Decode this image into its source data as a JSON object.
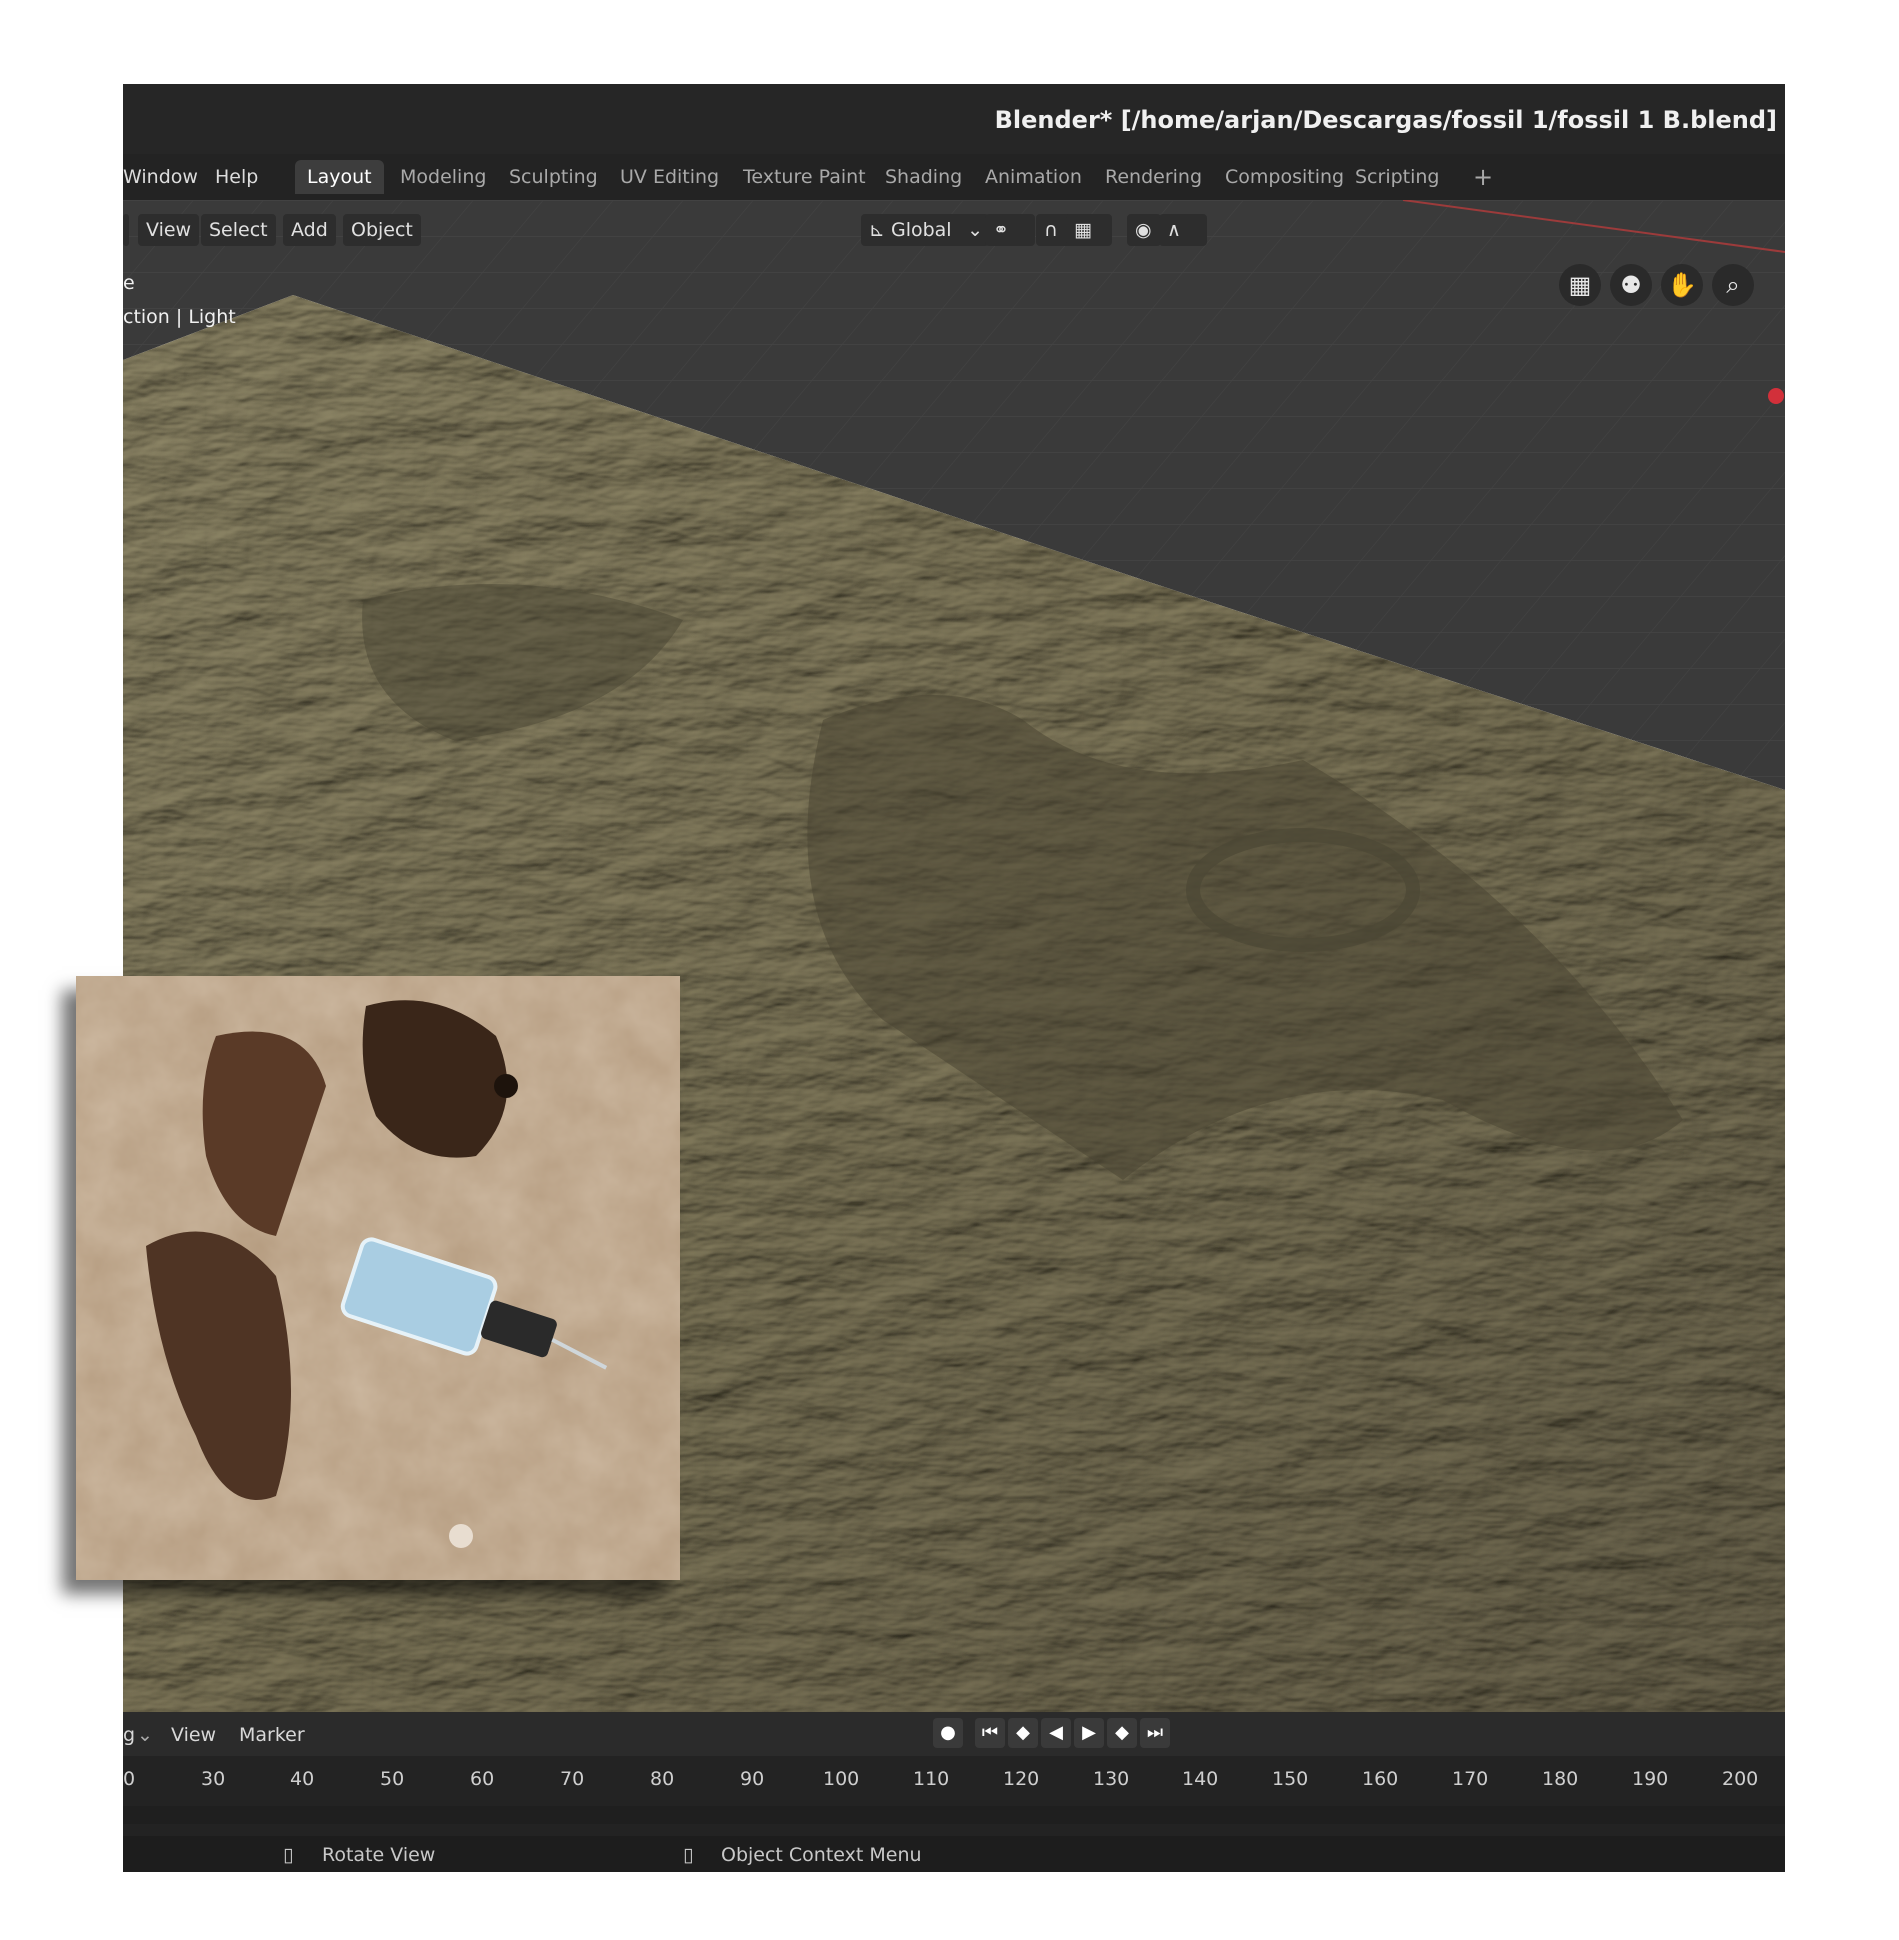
{
  "window": {
    "title": "Blender* [/home/arjan/Descargas/fossil 1/fossil 1 B.blend]"
  },
  "menubar": {
    "items": [
      "Window",
      "Help"
    ],
    "workspace_tabs": [
      "Layout",
      "Modeling",
      "Sculpting",
      "UV Editing",
      "Texture Paint",
      "Shading",
      "Animation",
      "Rendering",
      "Compositing",
      "Scripting"
    ],
    "active_tab": "Layout",
    "add_tab_icon": "plus-icon"
  },
  "viewport": {
    "header_menus": [
      "View",
      "Select",
      "Add",
      "Object"
    ],
    "orientation": "Global",
    "overlay_line_1": "e",
    "overlay_line_2": "ction | Light",
    "nav_gizmo_icons": [
      "grid-view-icon",
      "camera-icon",
      "hand-pan-icon",
      "zoom-icon"
    ],
    "colors": {
      "terrain": "#8b8363",
      "terrain_shadow": "#3c3828",
      "background": "#3a3a3a"
    }
  },
  "timeline": {
    "header_items": [
      "g",
      "View",
      "Marker"
    ],
    "playback_icons": [
      "record-icon",
      "jump-start-icon",
      "prev-keyframe-icon",
      "play-reverse-icon",
      "play-icon",
      "next-keyframe-icon",
      "jump-end-icon"
    ],
    "frames": [
      "0",
      "30",
      "40",
      "50",
      "60",
      "70",
      "80",
      "90",
      "100",
      "110",
      "120",
      "130",
      "140",
      "150",
      "160",
      "170",
      "180",
      "190",
      "200"
    ]
  },
  "statusbar": {
    "left_hint": "Rotate View",
    "right_hint": "Object Context Menu"
  }
}
